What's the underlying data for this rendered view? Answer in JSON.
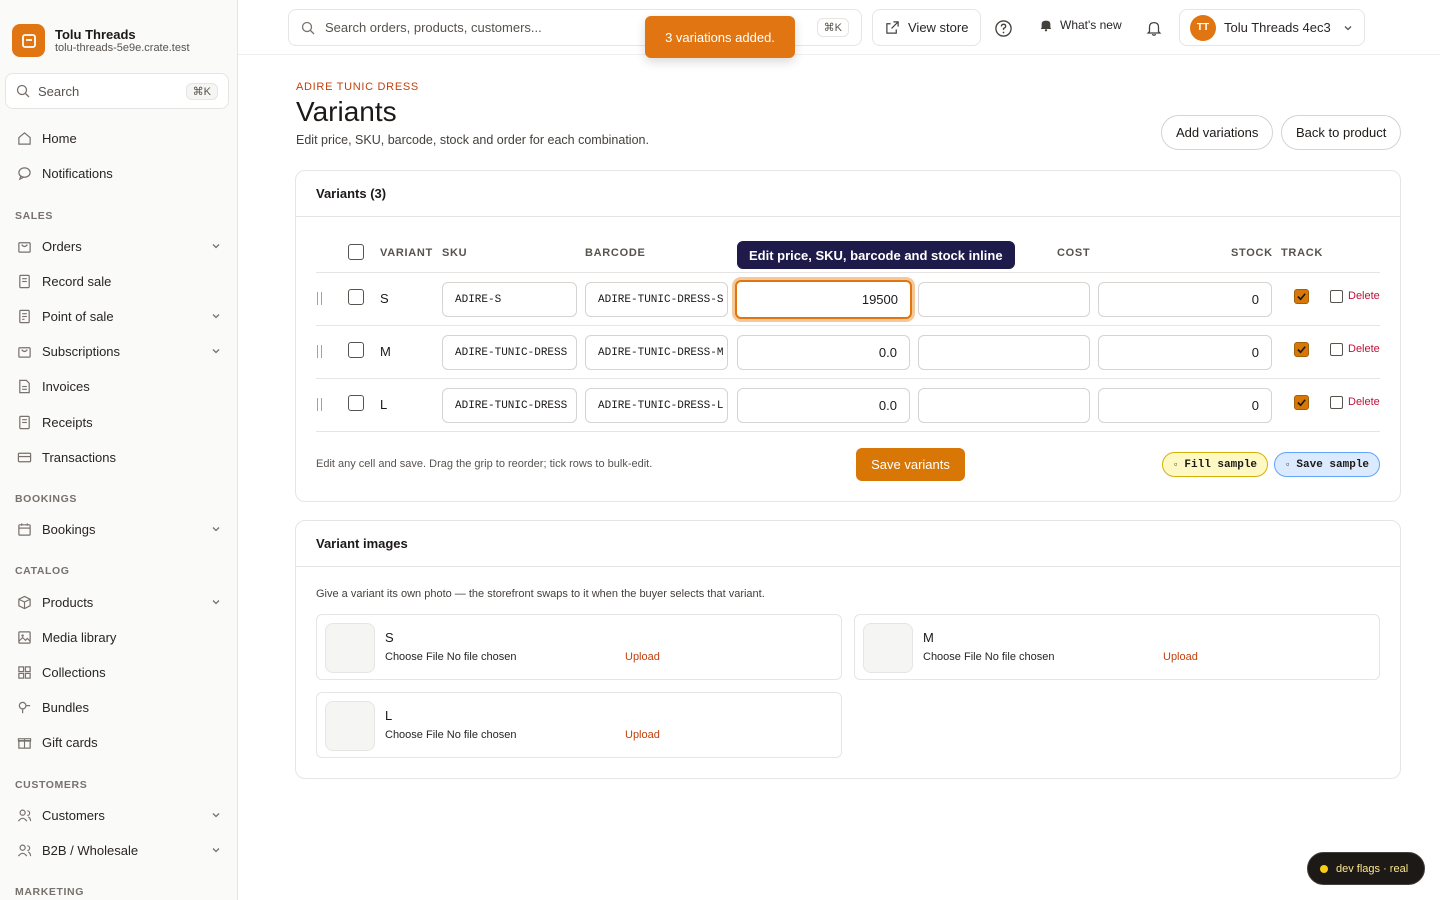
{
  "brand": {
    "name": "Tolu Threads",
    "domain": "tolu-threads-5e9e.crate.test",
    "accent": "#e07512"
  },
  "sidebar": {
    "search": {
      "label": "Search",
      "shortcut": "⌘K"
    },
    "items": [
      {
        "label": "Home",
        "icon": "home-icon"
      },
      {
        "label": "Notifications",
        "icon": "chat-bubble-icon"
      },
      {
        "label": "Orders",
        "icon": "bag-icon",
        "expandable": true
      },
      {
        "label": "Record sale",
        "icon": "receipt-icon"
      },
      {
        "label": "Point of sale",
        "icon": "register-icon",
        "expandable": true
      },
      {
        "label": "Subscriptions",
        "icon": "bag-icon",
        "expandable": true
      },
      {
        "label": "Invoices",
        "icon": "document-icon"
      },
      {
        "label": "Receipts",
        "icon": "receipt-icon"
      },
      {
        "label": "Transactions",
        "icon": "card-icon"
      },
      {
        "label": "Bookings",
        "icon": "calendar-icon",
        "expandable": true
      },
      {
        "label": "Products",
        "icon": "box-icon",
        "expandable": true
      },
      {
        "label": "Media library",
        "icon": "image-icon"
      },
      {
        "label": "Collections",
        "icon": "grid-icon"
      },
      {
        "label": "Bundles",
        "icon": "bundle-icon"
      },
      {
        "label": "Gift cards",
        "icon": "gift-icon"
      },
      {
        "label": "Customers",
        "icon": "users-icon",
        "expandable": true
      },
      {
        "label": "B2B / Wholesale",
        "icon": "users-icon",
        "expandable": true
      }
    ],
    "sections": [
      "SALES",
      "BOOKINGS",
      "CATALOG",
      "CUSTOMERS",
      "MARKETING"
    ]
  },
  "topbar": {
    "search_placeholder": "Search orders, products, customers...",
    "search_shortcut": "⌘K",
    "view_store": "View store",
    "whats_new": "What's new",
    "account": {
      "initials": "TT",
      "name": "Tolu Threads 4ec3"
    }
  },
  "toast": "3 variations added.",
  "page": {
    "eyebrow": "ADIRE TUNIC DRESS",
    "title": "Variants",
    "description": "Edit price, SKU, barcode, stock and order for each combination.",
    "add_variations": "Add variations",
    "back_to_product": "Back to product"
  },
  "variants_card": {
    "title": "Variants (3)",
    "columns": {
      "variant": "VARIANT",
      "sku": "SKU",
      "barcode": "BARCODE",
      "cost": "COST",
      "stock": "STOCK",
      "track": "TRACK"
    },
    "tooltip": "Edit price, SKU, barcode and stock inline",
    "rows": [
      {
        "name": "S",
        "sku": "ADIRE-S",
        "barcode": "ADIRE-TUNIC-DRESS-S",
        "price": "19500",
        "cost": "",
        "stock": "0",
        "track": true,
        "delete": "Delete"
      },
      {
        "name": "M",
        "sku": "ADIRE-TUNIC-DRESS",
        "barcode": "ADIRE-TUNIC-DRESS-M",
        "price": "0.0",
        "cost": "",
        "stock": "0",
        "track": true,
        "delete": "Delete"
      },
      {
        "name": "L",
        "sku": "ADIRE-TUNIC-DRESS",
        "barcode": "ADIRE-TUNIC-DRESS-L",
        "price": "0.0",
        "cost": "",
        "stock": "0",
        "track": true,
        "delete": "Delete"
      }
    ],
    "hint": "Edit any cell and save. Drag the grip to reorder; tick rows to bulk-edit.",
    "save": "Save variants",
    "fill_sample": "Fill sample",
    "save_sample": "Save sample"
  },
  "images_card": {
    "title": "Variant images",
    "description": "Give a variant its own photo — the storefront swaps to it when the buyer selects that variant.",
    "items": [
      {
        "name": "S",
        "file": "Choose File  No file chosen",
        "upload": "Upload"
      },
      {
        "name": "M",
        "file": "Choose File  No file chosen",
        "upload": "Upload"
      },
      {
        "name": "L",
        "file": "Choose File  No file chosen",
        "upload": "Upload"
      }
    ]
  },
  "dev_flags": "dev flags · real"
}
